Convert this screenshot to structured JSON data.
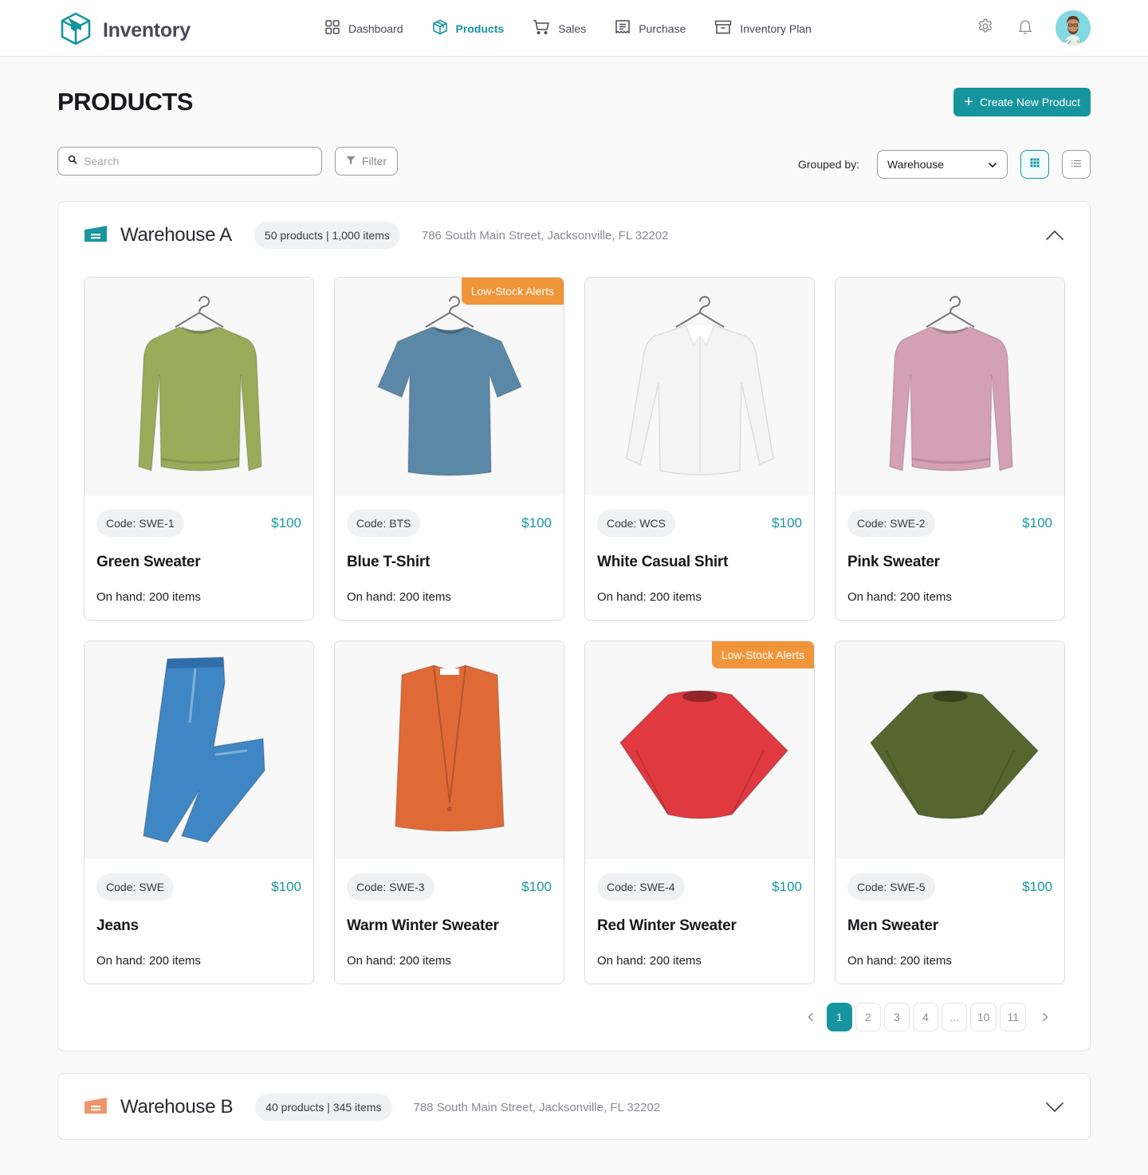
{
  "app": {
    "title": "Inventory"
  },
  "nav": [
    {
      "label": "Dashboard",
      "icon": "grid-icon",
      "active": false
    },
    {
      "label": "Products",
      "icon": "box-icon",
      "active": true
    },
    {
      "label": "Sales",
      "icon": "cart-icon",
      "active": false
    },
    {
      "label": "Purchase",
      "icon": "receipt-icon",
      "active": false
    },
    {
      "label": "Inventory Plan",
      "icon": "archive-icon",
      "active": false
    }
  ],
  "header_icons": [
    "gear-icon",
    "bell-icon",
    "avatar"
  ],
  "page": {
    "title": "PRODUCTS",
    "create_label": "Create New Product"
  },
  "toolbar": {
    "search_placeholder": "Search",
    "filter_label": "Filter",
    "grouped_by_label": "Grouped by:",
    "grouped_by_value": "Warehouse",
    "view_mode": "grid"
  },
  "colors": {
    "accent": "#16959f",
    "alert": "#f0953a",
    "warehouse_b": "#f0956a"
  },
  "warehouses": [
    {
      "name": "Warehouse A",
      "badge": "50 products | 1,000 items",
      "address": "786 South Main Street, Jacksonville, FL 32202",
      "expanded": true,
      "products": [
        {
          "code": "Code: SWE-1",
          "price": "$100",
          "name": "Green Sweater",
          "on_hand": "On hand: 200 items",
          "alert": "",
          "kind": "sweater",
          "color": "#9aab5a"
        },
        {
          "code": "Code: BTS",
          "price": "$100",
          "name": "Blue T-Shirt",
          "on_hand": "On hand: 200 items",
          "alert": "Low-Stock Alerts",
          "kind": "tshirt",
          "color": "#5b88a6"
        },
        {
          "code": "Code: WCS",
          "price": "$100",
          "name": "White Casual Shirt",
          "on_hand": "On hand: 200 items",
          "alert": "",
          "kind": "shirt",
          "color": "#f4f4f4"
        },
        {
          "code": "Code: SWE-2",
          "price": "$100",
          "name": "Pink Sweater",
          "on_hand": "On hand: 200 items",
          "alert": "",
          "kind": "sweater",
          "color": "#d4a0b3"
        },
        {
          "code": "Code: SWE",
          "price": "$100",
          "name": "Jeans",
          "on_hand": "On hand: 200 items",
          "alert": "",
          "kind": "jeans",
          "color": "#3f86c4"
        },
        {
          "code": "Code: SWE-3",
          "price": "$100",
          "name": "Warm Winter Sweater",
          "on_hand": "On hand: 200 items",
          "alert": "",
          "kind": "cardigan",
          "color": "#e06a36"
        },
        {
          "code": "Code: SWE-4",
          "price": "$100",
          "name": "Red Winter Sweater",
          "on_hand": "On hand: 200 items",
          "alert": "Low-Stock Alerts",
          "kind": "folded",
          "color": "#e0393f"
        },
        {
          "code": "Code: SWE-5",
          "price": "$100",
          "name": "Men Sweater",
          "on_hand": "On hand: 200 items",
          "alert": "",
          "kind": "folded",
          "color": "#55672f"
        }
      ],
      "pagination": {
        "pages": [
          "1",
          "2",
          "3",
          "4",
          "...",
          "10",
          "11"
        ],
        "current": "1"
      }
    },
    {
      "name": "Warehouse B",
      "badge": "40 products | 345 items",
      "address": "788 South Main Street, Jacksonville, FL 32202",
      "expanded": false
    }
  ]
}
